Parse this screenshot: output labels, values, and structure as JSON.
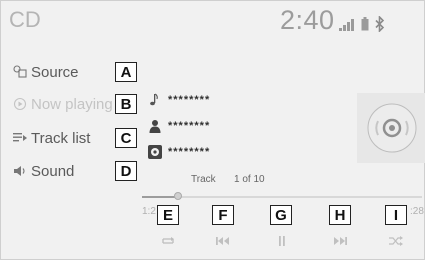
{
  "header": {
    "title": "CD",
    "clock": "2:40"
  },
  "menu": [
    {
      "label": "Source",
      "icon": "source-icon",
      "dim": false
    },
    {
      "label": "Now playing",
      "icon": "now-playing-icon",
      "dim": true
    },
    {
      "label": "Track list",
      "icon": "track-list-icon",
      "dim": false
    },
    {
      "label": "Sound",
      "icon": "sound-icon",
      "dim": false
    }
  ],
  "callouts": [
    "A",
    "B",
    "C",
    "D",
    "E",
    "F",
    "G",
    "H",
    "I"
  ],
  "info": {
    "song": "********",
    "artist": "********",
    "album": "********"
  },
  "track": {
    "label": "Track",
    "position": "1 of 10"
  },
  "progress": {
    "elapsed": "1:2",
    "total": ":28",
    "fraction": 0.13
  },
  "controls": [
    "repeat-icon",
    "previous-track-icon",
    "pause-icon",
    "next-track-icon",
    "shuffle-icon"
  ],
  "colors": {
    "background": "#f1f1f1",
    "text": "#5a5a5a",
    "dim_text": "#c4c4c4"
  }
}
